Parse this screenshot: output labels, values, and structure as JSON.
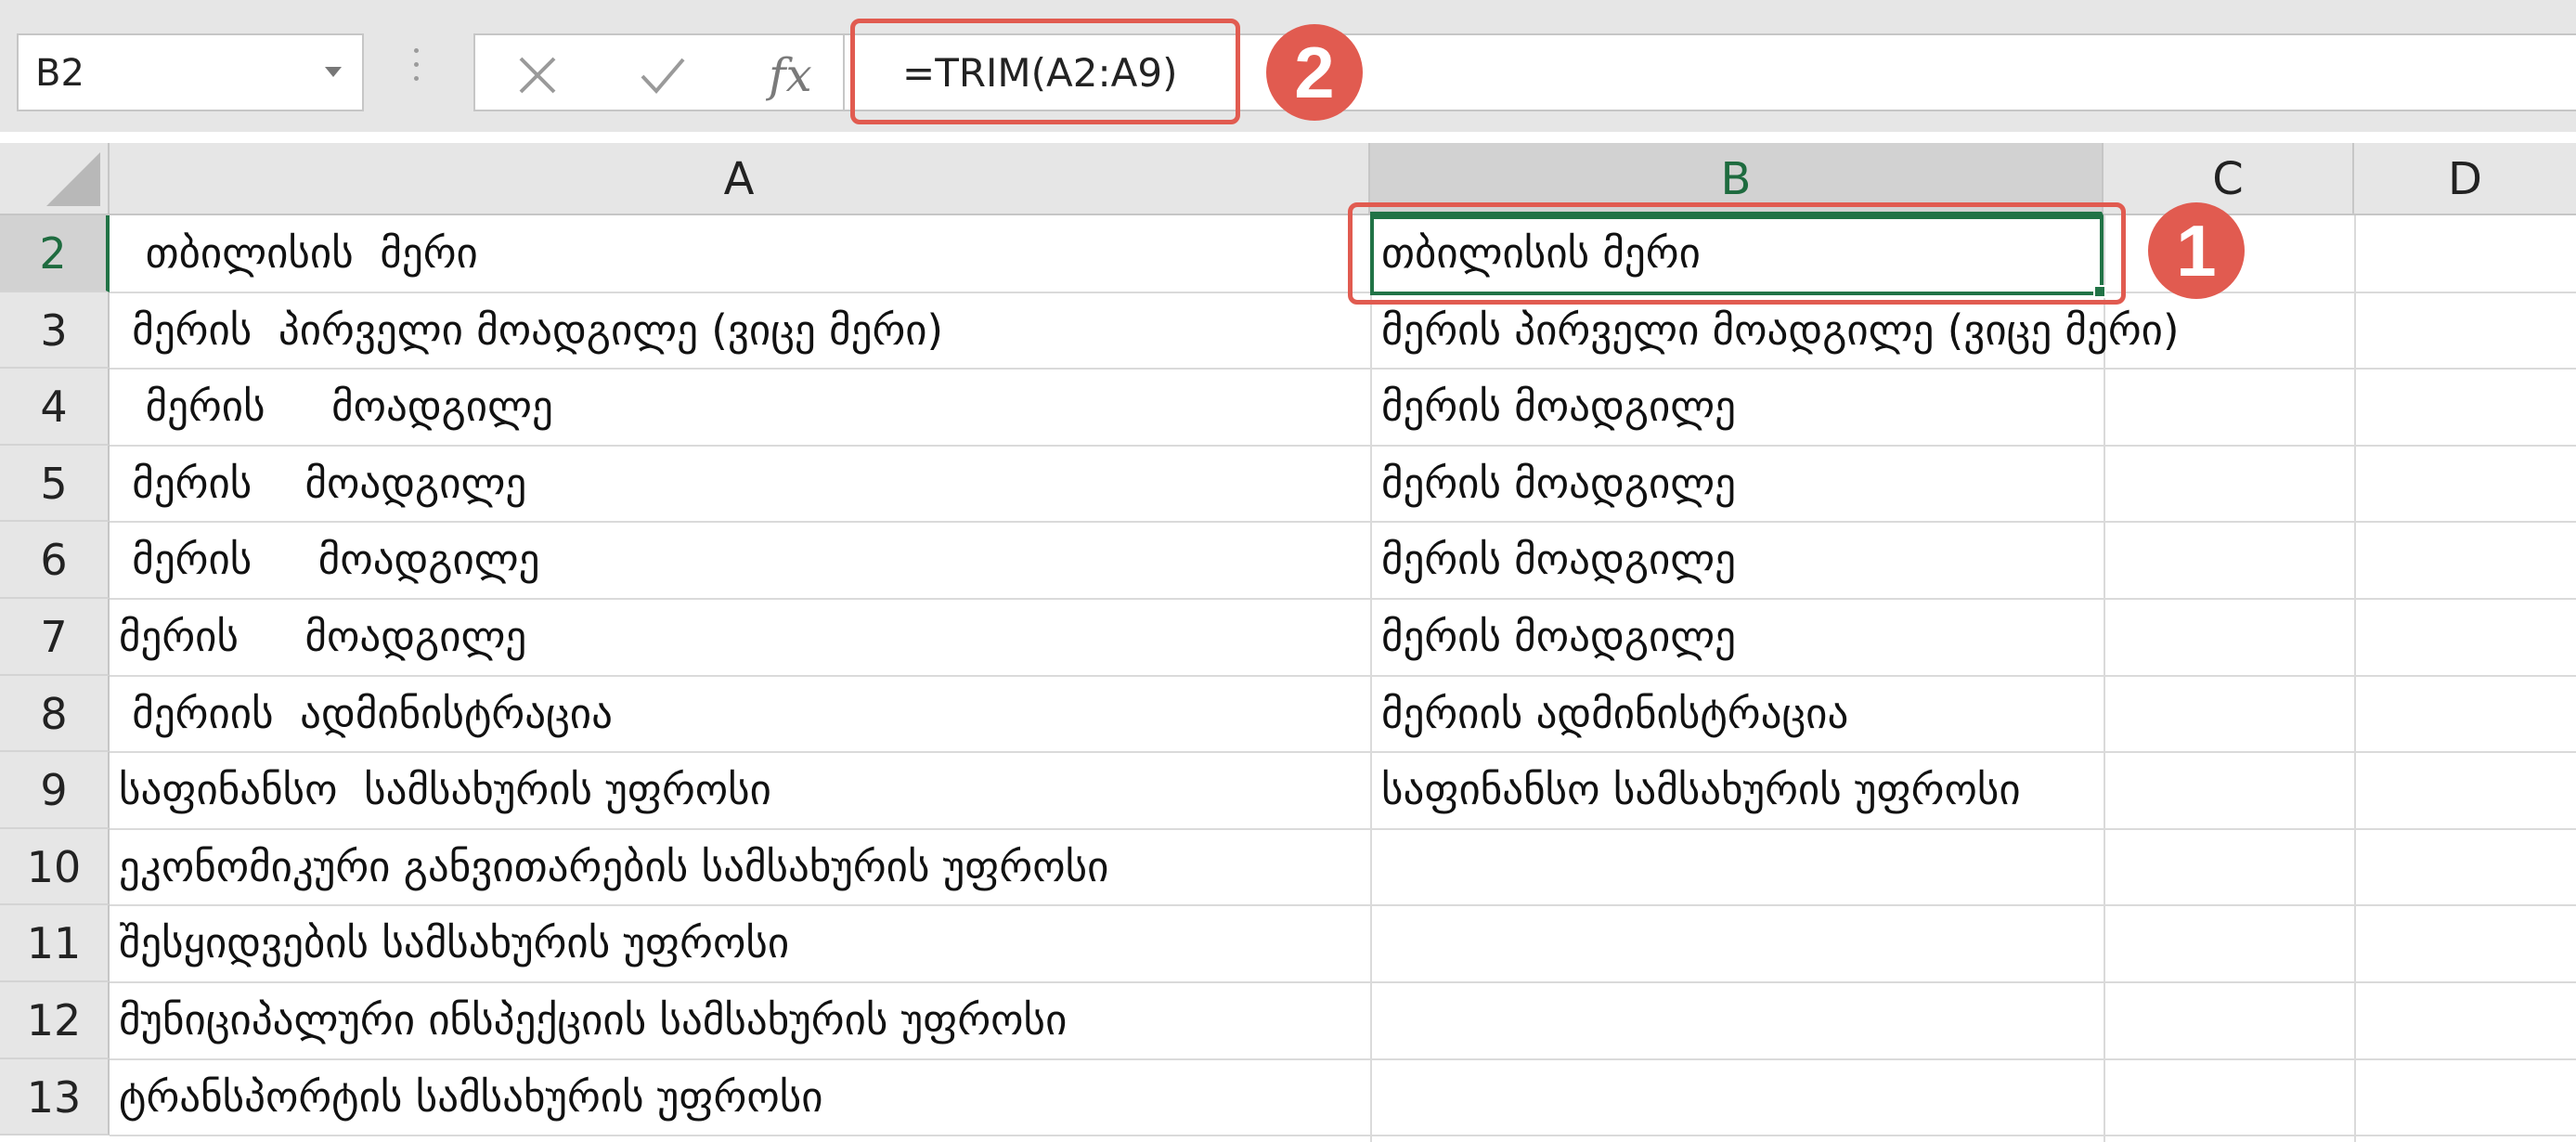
{
  "formula_bar": {
    "name_box": "B2",
    "formula": "=TRIM(A2:A9)",
    "cancel_icon": "close-icon",
    "enter_icon": "check-icon",
    "function_icon": "fx-icon",
    "fx_label": "fx"
  },
  "callouts": {
    "cell_badge": "1",
    "formula_badge": "2",
    "accent_color": "#e15b50"
  },
  "columns": [
    "A",
    "B",
    "C",
    "D"
  ],
  "selected_column": "B",
  "rows": [
    {
      "num": "2",
      "a": "  თბილისის  მერი",
      "b": "თბილისის მერი"
    },
    {
      "num": "3",
      "a": " მერის  პირველი მოადგილე (ვიცე მერი)",
      "b": "მერის პირველი მოადგილე (ვიცე მერი)"
    },
    {
      "num": "4",
      "a": "  მერის     მოადგილე",
      "b": "მერის მოადგილე"
    },
    {
      "num": "5",
      "a": " მერის    მოადგილე",
      "b": "მერის მოადგილე"
    },
    {
      "num": "6",
      "a": " მერის     მოადგილე",
      "b": "მერის მოადგილე"
    },
    {
      "num": "7",
      "a": "მერის     მოადგილე",
      "b": "მერის მოადგილე"
    },
    {
      "num": "8",
      "a": " მერიის  ადმინისტრაცია",
      "b": "მერიის ადმინისტრაცია"
    },
    {
      "num": "9",
      "a": "საფინანსო  სამსახურის უფროსი",
      "b": "საფინანსო სამსახურის უფროსი"
    },
    {
      "num": "10",
      "a": "ეკონომიკური განვითარების სამსახურის უფროსი",
      "b": ""
    },
    {
      "num": "11",
      "a": "შესყიდვების სამსახურის უფროსი",
      "b": ""
    },
    {
      "num": "12",
      "a": "მუნიციპალური ინსპექციის სამსახურის უფროსი",
      "b": ""
    },
    {
      "num": "13",
      "a": "ტრანსპორტის სამსახურის უფროსი",
      "b": ""
    }
  ],
  "selection": {
    "cell": "B2",
    "color": "#217346"
  }
}
